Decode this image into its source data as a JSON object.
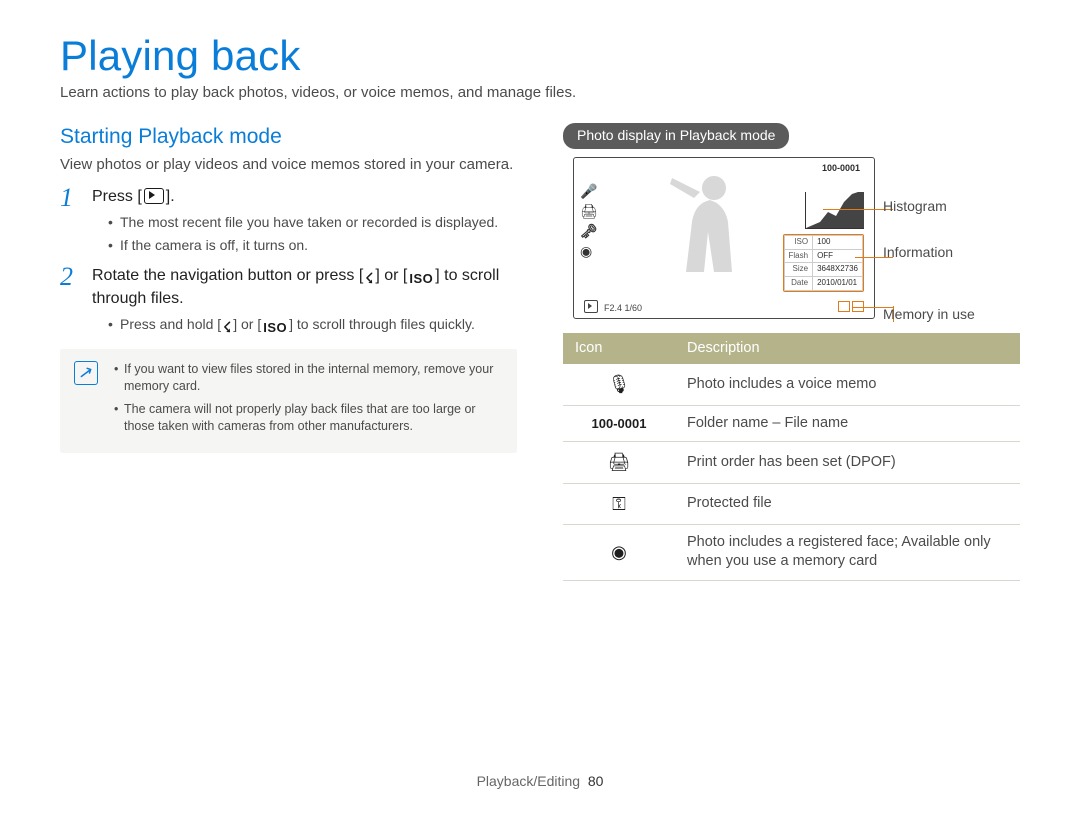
{
  "title": "Playing back",
  "intro": "Learn actions to play back photos, videos, or voice memos, and manage files.",
  "left": {
    "section_heading": "Starting Playback mode",
    "section_para": "View photos or play videos and voice memos stored in your camera.",
    "step1": {
      "num": "1",
      "text_a": "Press [",
      "text_b": "].",
      "bullets": [
        "The most recent file you have taken or recorded is displayed.",
        "If the camera is off, it turns on."
      ]
    },
    "step2": {
      "num": "2",
      "text_a": "Rotate the navigation button or press [",
      "flash": "☇",
      "text_b": "] or [",
      "iso": "ISO",
      "text_c": "] to scroll through files.",
      "bullet_a": "Press and hold [",
      "bullet_b": "] or [",
      "bullet_c": "] to scroll through files quickly."
    },
    "note": [
      "If you want to view files stored in the internal memory, remove your memory card.",
      "The camera will not properly play back files that are too large or those taken with cameras from other manufacturers."
    ]
  },
  "right": {
    "pill": "Photo display in Playback mode",
    "lcd": {
      "filelabel": "100-0001",
      "info": {
        "iso_k": "ISO",
        "iso_v": "100",
        "flash_k": "Flash",
        "flash_v": "OFF",
        "size_k": "Size",
        "size_v": "3648X2736",
        "date_k": "Date",
        "date_v": "2010/01/01"
      },
      "bottom_left": "F2.4  1/60"
    },
    "callouts": {
      "histogram": "Histogram",
      "information": "Information",
      "memory": "Memory in use"
    },
    "table": {
      "h_icon": "Icon",
      "h_desc": "Description",
      "rows": [
        {
          "icon": "🎙",
          "desc": "Photo includes a voice memo"
        },
        {
          "icon": "100-0001",
          "desc": "Folder name – File name"
        },
        {
          "icon": "🖨",
          "desc": "Print order has been set (DPOF)"
        },
        {
          "icon": "⚿",
          "desc": "Protected file"
        },
        {
          "icon": "◉",
          "desc": "Photo includes a registered face; Available only when you use a memory card"
        }
      ]
    }
  },
  "footer": {
    "section": "Playback/Editing",
    "page": "80"
  }
}
